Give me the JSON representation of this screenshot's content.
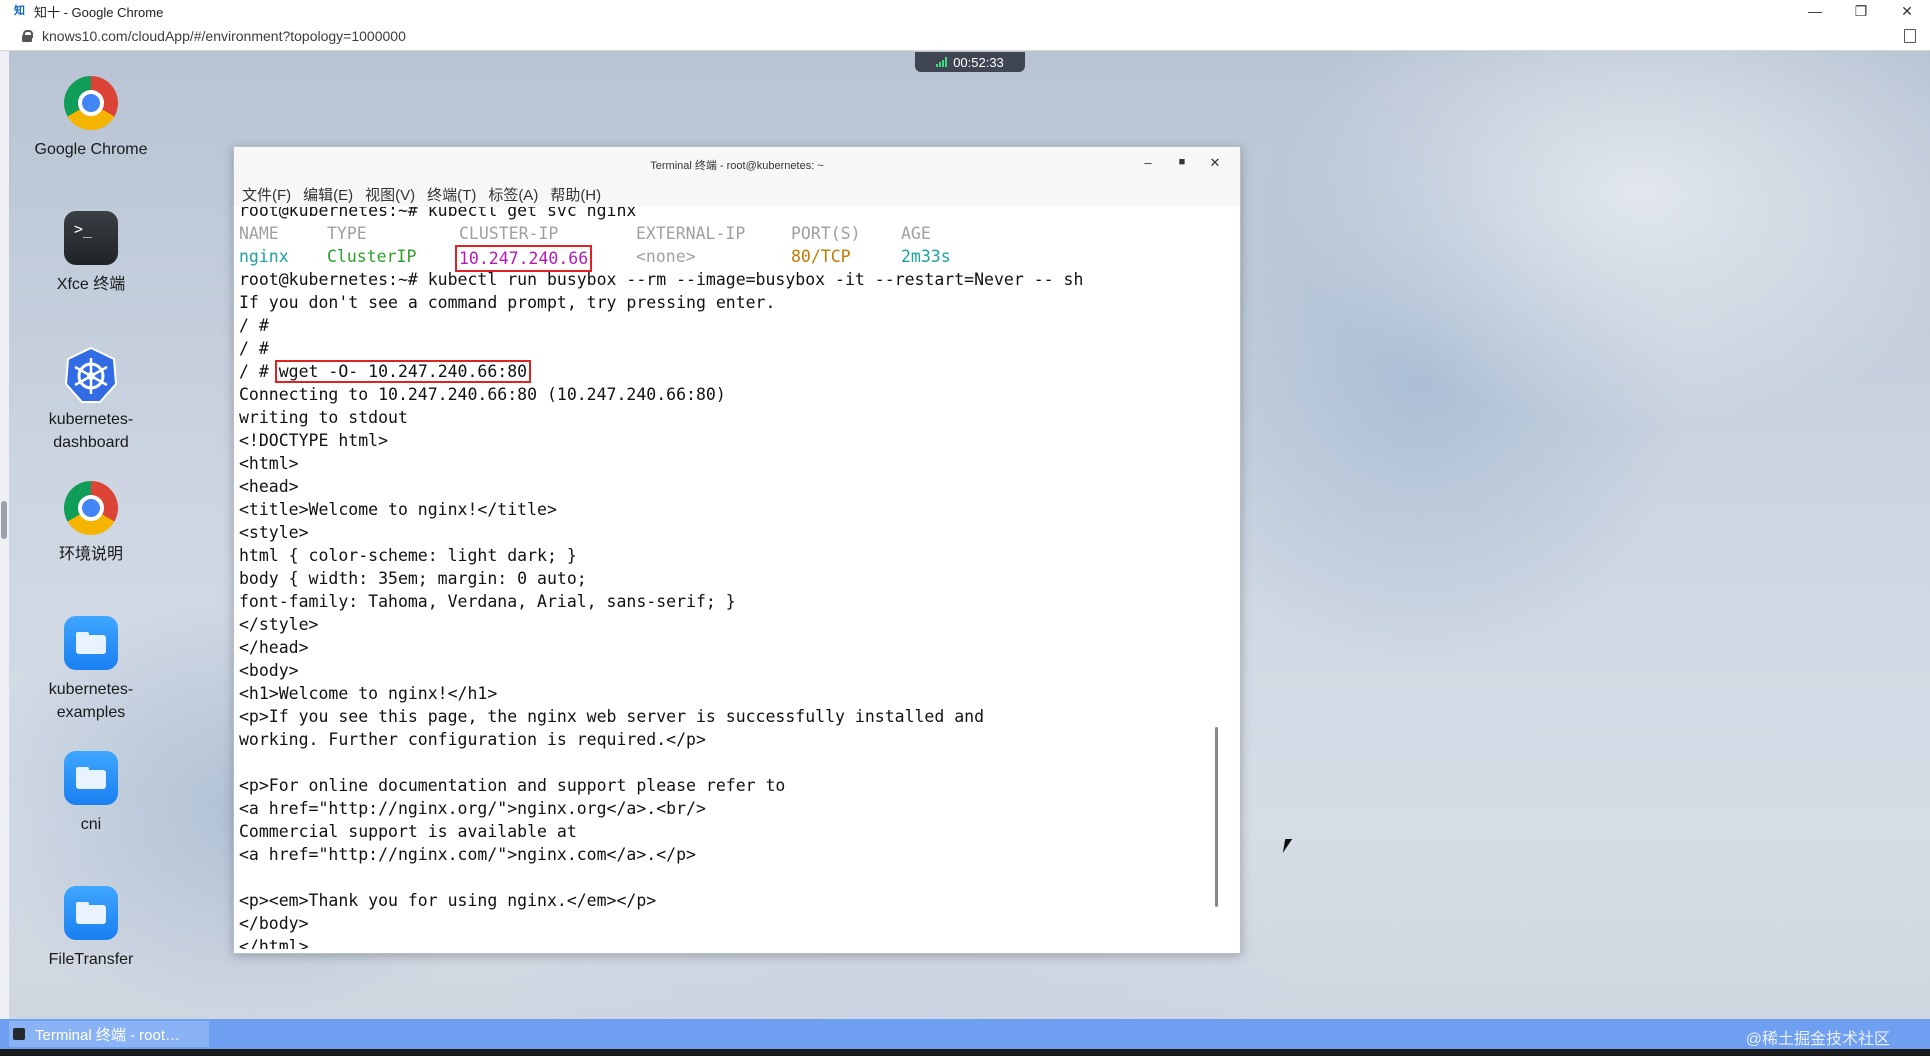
{
  "browser": {
    "favicon": "知",
    "title": "知十 - Google Chrome",
    "url": "knows10.com/cloudApp/#/environment?topology=1000000",
    "minimize": "—",
    "restore": "❐",
    "close": "✕"
  },
  "timer": {
    "time": "00:52:33"
  },
  "desktop_icons": [
    {
      "label": "Google Chrome",
      "icon": "chrome-icon"
    },
    {
      "label": "Xfce 终端",
      "icon": "terminal-icon",
      "glyph": ">_"
    },
    {
      "label_line1": "kubernetes-",
      "label_line2": "dashboard",
      "icon": "kubernetes-icon"
    },
    {
      "label": "环境说明",
      "icon": "chrome-icon"
    },
    {
      "label_line1": "kubernetes-",
      "label_line2": "examples",
      "icon": "folder-icon"
    },
    {
      "label": "cni",
      "icon": "folder-icon"
    },
    {
      "label": "FileTransfer",
      "icon": "folder-icon"
    }
  ],
  "terminal": {
    "title": "Terminal 终端 - root@kubernetes: ~",
    "menu": [
      "文件(F)",
      "编辑(E)",
      "视图(V)",
      "终端(T)",
      "标签(A)",
      "帮助(H)"
    ],
    "cmd1": "root@kubernetes:~# kubectl get svc nginx",
    "svc_header": {
      "name": "NAME",
      "type": "TYPE",
      "cluster_ip": "CLUSTER-IP",
      "external_ip": "EXTERNAL-IP",
      "ports": "PORT(S)",
      "age": "AGE"
    },
    "svc_row": {
      "name": "nginx",
      "type": "ClusterIP",
      "cluster_ip": "10.247.240.66",
      "external_ip": "<none>",
      "ports": "80/TCP",
      "age": "2m33s"
    },
    "cmd2": "root@kubernetes:~# kubectl run busybox --rm --image=busybox -it --restart=Never -- sh",
    "l_prompt_hint": "If you don't see a command prompt, try pressing enter.",
    "l_prompt1": "/ #",
    "l_prompt2": "/ #",
    "wget_prompt": "/ #",
    "wget_cmd": "wget -O- 10.247.240.66:80",
    "output": [
      "Connecting to 10.247.240.66:80 (10.247.240.66:80)",
      "writing to stdout",
      "<!DOCTYPE html>",
      "<html>",
      "<head>",
      "<title>Welcome to nginx!</title>",
      "<style>",
      "html { color-scheme: light dark; }",
      "body { width: 35em; margin: 0 auto;",
      "font-family: Tahoma, Verdana, Arial, sans-serif; }",
      "</style>",
      "</head>",
      "<body>",
      "<h1>Welcome to nginx!</h1>",
      "<p>If you see this page, the nginx web server is successfully installed and",
      "working. Further configuration is required.</p>",
      "",
      "<p>For online documentation and support please refer to",
      "<a href=\"http://nginx.org/\">nginx.org</a>.<br/>",
      "Commercial support is available at",
      "<a href=\"http://nginx.com/\">nginx.com</a>.</p>",
      "",
      "<p><em>Thank you for using nginx.</em></p>",
      "</body>",
      "</html>"
    ]
  },
  "taskbar": {
    "active_task": "Terminal 终端 - root…",
    "watermark": "@稀土掘金技术社区"
  },
  "colors": {
    "svc_name": "#1aa3a3",
    "svc_type": "#2aa22a",
    "cluster_ip": "#b61ab6",
    "external_ip": "#a0a0a0",
    "ports": "#c27a00",
    "age": "#1aa3a3",
    "highlight_box": "#e02222"
  }
}
